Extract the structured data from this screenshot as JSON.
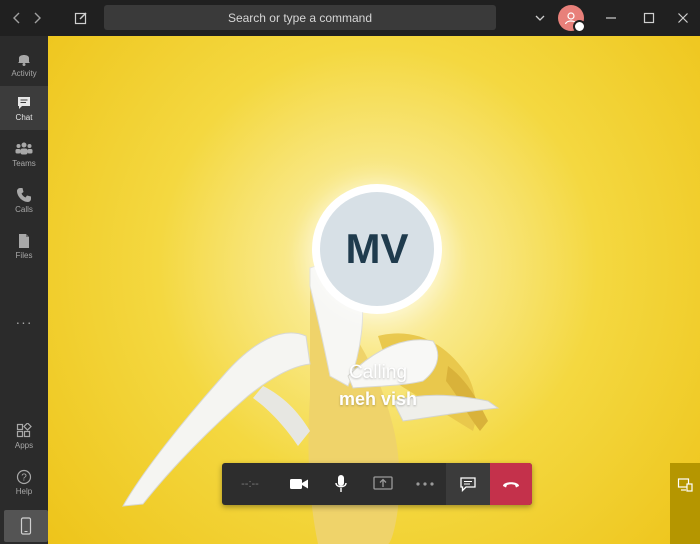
{
  "titlebar": {
    "search_placeholder": "Search or type a command",
    "icons": [
      "back-icon",
      "forward-icon",
      "compose-icon",
      "chevron-down-icon",
      "minimize-icon",
      "maximize-icon",
      "close-icon"
    ]
  },
  "rail": {
    "items": [
      {
        "label": "Activity",
        "icon": "bell-icon"
      },
      {
        "label": "Chat",
        "icon": "chat-icon",
        "active": true
      },
      {
        "label": "Teams",
        "icon": "teams-icon"
      },
      {
        "label": "Calls",
        "icon": "phone-icon"
      },
      {
        "label": "Files",
        "icon": "file-icon"
      }
    ],
    "more": "···",
    "bottom": [
      {
        "label": "Apps",
        "icon": "apps-icon"
      },
      {
        "label": "Help",
        "icon": "help-icon"
      }
    ]
  },
  "call": {
    "avatar_initials": "MV",
    "status": "Calling",
    "callee_name": "meh vish",
    "timer": "--:--",
    "hangup_color": "#c4314b"
  },
  "colors": {
    "background_yellow": "#f4d840",
    "controls_bg": "#2d2d2d"
  }
}
